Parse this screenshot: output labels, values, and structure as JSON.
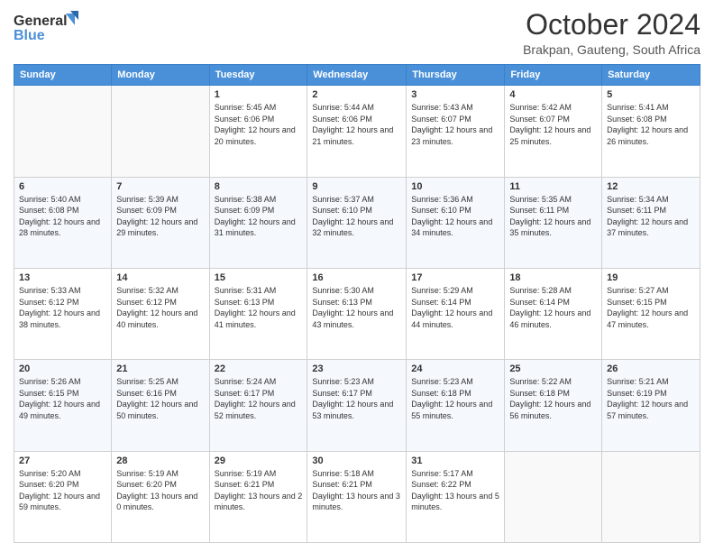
{
  "header": {
    "logo_line1": "General",
    "logo_line2": "Blue",
    "month_title": "October 2024",
    "location": "Brakpan, Gauteng, South Africa"
  },
  "days_of_week": [
    "Sunday",
    "Monday",
    "Tuesday",
    "Wednesday",
    "Thursday",
    "Friday",
    "Saturday"
  ],
  "weeks": [
    [
      {
        "day": "",
        "info": ""
      },
      {
        "day": "",
        "info": ""
      },
      {
        "day": "1",
        "info": "Sunrise: 5:45 AM\nSunset: 6:06 PM\nDaylight: 12 hours and 20 minutes."
      },
      {
        "day": "2",
        "info": "Sunrise: 5:44 AM\nSunset: 6:06 PM\nDaylight: 12 hours and 21 minutes."
      },
      {
        "day": "3",
        "info": "Sunrise: 5:43 AM\nSunset: 6:07 PM\nDaylight: 12 hours and 23 minutes."
      },
      {
        "day": "4",
        "info": "Sunrise: 5:42 AM\nSunset: 6:07 PM\nDaylight: 12 hours and 25 minutes."
      },
      {
        "day": "5",
        "info": "Sunrise: 5:41 AM\nSunset: 6:08 PM\nDaylight: 12 hours and 26 minutes."
      }
    ],
    [
      {
        "day": "6",
        "info": "Sunrise: 5:40 AM\nSunset: 6:08 PM\nDaylight: 12 hours and 28 minutes."
      },
      {
        "day": "7",
        "info": "Sunrise: 5:39 AM\nSunset: 6:09 PM\nDaylight: 12 hours and 29 minutes."
      },
      {
        "day": "8",
        "info": "Sunrise: 5:38 AM\nSunset: 6:09 PM\nDaylight: 12 hours and 31 minutes."
      },
      {
        "day": "9",
        "info": "Sunrise: 5:37 AM\nSunset: 6:10 PM\nDaylight: 12 hours and 32 minutes."
      },
      {
        "day": "10",
        "info": "Sunrise: 5:36 AM\nSunset: 6:10 PM\nDaylight: 12 hours and 34 minutes."
      },
      {
        "day": "11",
        "info": "Sunrise: 5:35 AM\nSunset: 6:11 PM\nDaylight: 12 hours and 35 minutes."
      },
      {
        "day": "12",
        "info": "Sunrise: 5:34 AM\nSunset: 6:11 PM\nDaylight: 12 hours and 37 minutes."
      }
    ],
    [
      {
        "day": "13",
        "info": "Sunrise: 5:33 AM\nSunset: 6:12 PM\nDaylight: 12 hours and 38 minutes."
      },
      {
        "day": "14",
        "info": "Sunrise: 5:32 AM\nSunset: 6:12 PM\nDaylight: 12 hours and 40 minutes."
      },
      {
        "day": "15",
        "info": "Sunrise: 5:31 AM\nSunset: 6:13 PM\nDaylight: 12 hours and 41 minutes."
      },
      {
        "day": "16",
        "info": "Sunrise: 5:30 AM\nSunset: 6:13 PM\nDaylight: 12 hours and 43 minutes."
      },
      {
        "day": "17",
        "info": "Sunrise: 5:29 AM\nSunset: 6:14 PM\nDaylight: 12 hours and 44 minutes."
      },
      {
        "day": "18",
        "info": "Sunrise: 5:28 AM\nSunset: 6:14 PM\nDaylight: 12 hours and 46 minutes."
      },
      {
        "day": "19",
        "info": "Sunrise: 5:27 AM\nSunset: 6:15 PM\nDaylight: 12 hours and 47 minutes."
      }
    ],
    [
      {
        "day": "20",
        "info": "Sunrise: 5:26 AM\nSunset: 6:15 PM\nDaylight: 12 hours and 49 minutes."
      },
      {
        "day": "21",
        "info": "Sunrise: 5:25 AM\nSunset: 6:16 PM\nDaylight: 12 hours and 50 minutes."
      },
      {
        "day": "22",
        "info": "Sunrise: 5:24 AM\nSunset: 6:17 PM\nDaylight: 12 hours and 52 minutes."
      },
      {
        "day": "23",
        "info": "Sunrise: 5:23 AM\nSunset: 6:17 PM\nDaylight: 12 hours and 53 minutes."
      },
      {
        "day": "24",
        "info": "Sunrise: 5:23 AM\nSunset: 6:18 PM\nDaylight: 12 hours and 55 minutes."
      },
      {
        "day": "25",
        "info": "Sunrise: 5:22 AM\nSunset: 6:18 PM\nDaylight: 12 hours and 56 minutes."
      },
      {
        "day": "26",
        "info": "Sunrise: 5:21 AM\nSunset: 6:19 PM\nDaylight: 12 hours and 57 minutes."
      }
    ],
    [
      {
        "day": "27",
        "info": "Sunrise: 5:20 AM\nSunset: 6:20 PM\nDaylight: 12 hours and 59 minutes."
      },
      {
        "day": "28",
        "info": "Sunrise: 5:19 AM\nSunset: 6:20 PM\nDaylight: 13 hours and 0 minutes."
      },
      {
        "day": "29",
        "info": "Sunrise: 5:19 AM\nSunset: 6:21 PM\nDaylight: 13 hours and 2 minutes."
      },
      {
        "day": "30",
        "info": "Sunrise: 5:18 AM\nSunset: 6:21 PM\nDaylight: 13 hours and 3 minutes."
      },
      {
        "day": "31",
        "info": "Sunrise: 5:17 AM\nSunset: 6:22 PM\nDaylight: 13 hours and 5 minutes."
      },
      {
        "day": "",
        "info": ""
      },
      {
        "day": "",
        "info": ""
      }
    ]
  ]
}
